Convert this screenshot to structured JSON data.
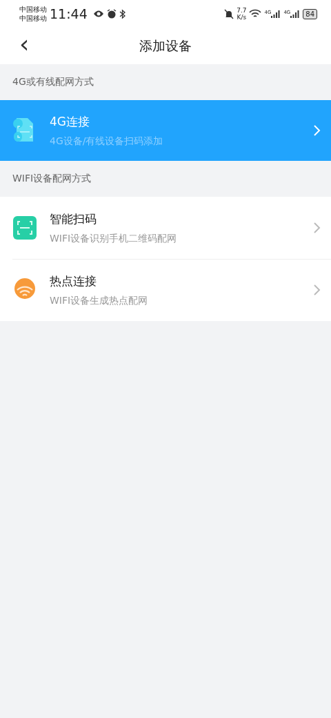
{
  "status_bar": {
    "carriers": [
      "中国移动",
      "中国移动"
    ],
    "time": "11:44",
    "speed_value": "7.7",
    "speed_unit": "K/s",
    "networks": [
      "4G",
      "4G"
    ],
    "battery": "84"
  },
  "header": {
    "back": "‹",
    "title": "添加设备"
  },
  "sections": [
    {
      "title": "4G或有线配网方式",
      "items": [
        {
          "kind": "sim",
          "title": "4G连接",
          "subtitle": "4G设备/有线设备扫码添加",
          "selected": true
        }
      ]
    },
    {
      "title": "WIFI设备配网方式",
      "items": [
        {
          "kind": "scan",
          "title": "智能扫码",
          "subtitle": "WIFI设备识别手机二维码配网",
          "selected": false
        },
        {
          "kind": "hotspot",
          "title": "热点连接",
          "subtitle": "WIFI设备生成热点配网",
          "selected": false
        }
      ]
    }
  ]
}
